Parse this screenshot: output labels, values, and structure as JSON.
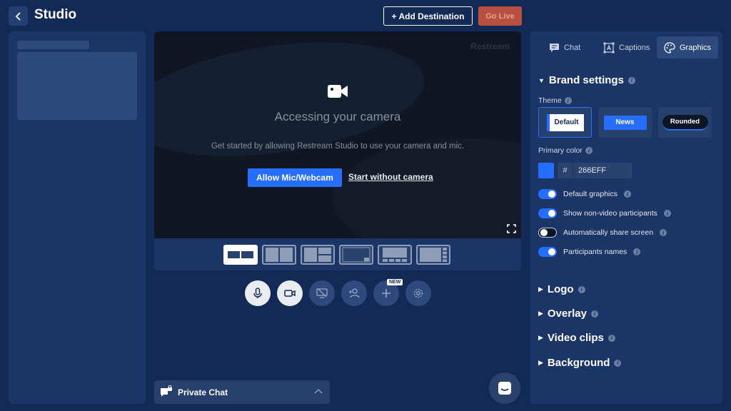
{
  "header": {
    "title": "Studio",
    "add_destination_label": "+ Add Destination",
    "go_live_label": "Go Live"
  },
  "stage": {
    "watermark": "Restream",
    "heading": "Accessing your camera",
    "message": "Get started by allowing Restream Studio to use your camera and mic.",
    "allow_button": "Allow Mic/Webcam",
    "start_without_camera": "Start without camera"
  },
  "controls": {
    "new_badge": "NEW"
  },
  "private_chat": {
    "label": "Private Chat"
  },
  "tabs": [
    {
      "label": "Chat"
    },
    {
      "label": "Captions"
    },
    {
      "label": "Graphics"
    }
  ],
  "graphics": {
    "brand_settings": "Brand settings",
    "theme_label": "Theme",
    "themes": [
      "Default",
      "News",
      "Rounded"
    ],
    "primary_color_label": "Primary color",
    "hex_prefix": "#",
    "primary_color_value": "266EFF",
    "primary_color": "#266EFF",
    "toggles": [
      {
        "label": "Default graphics",
        "on": true
      },
      {
        "label": "Show non-video participants",
        "on": true
      },
      {
        "label": "Automatically share screen",
        "on": false
      },
      {
        "label": "Participants names",
        "on": true
      }
    ],
    "sections": [
      "Logo",
      "Overlay",
      "Video clips",
      "Background"
    ]
  }
}
